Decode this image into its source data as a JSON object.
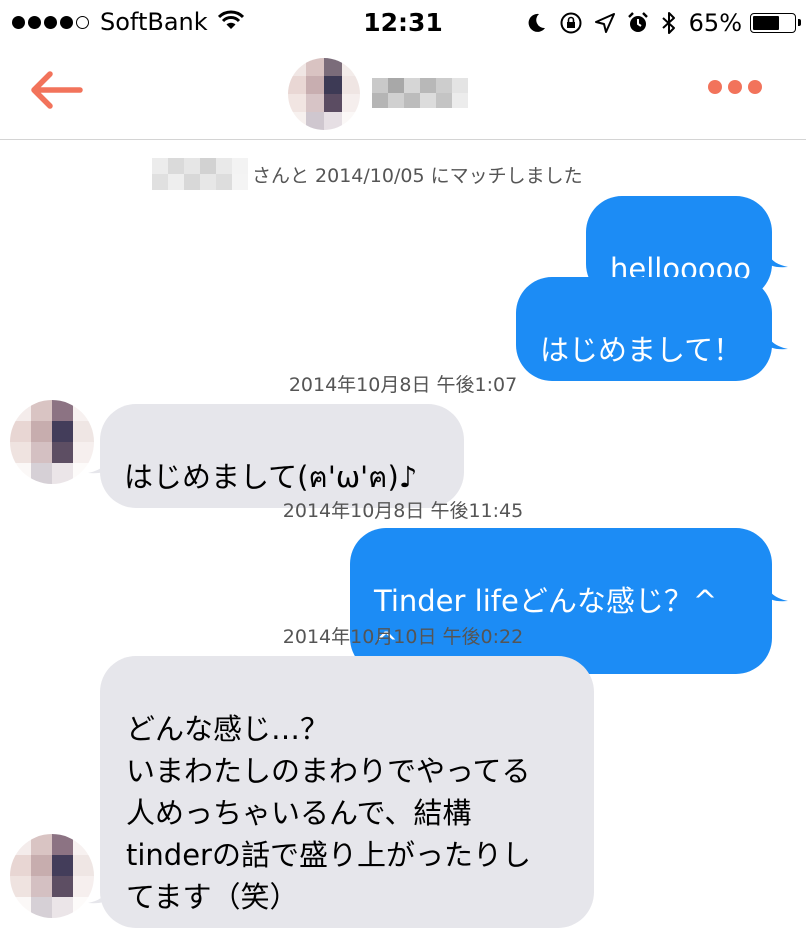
{
  "status_bar": {
    "carrier": "SoftBank",
    "time": "12:31",
    "battery": "65%",
    "battery_level": 0.65,
    "icons": [
      "signal-dots-icon",
      "wifi-icon",
      "moon-icon",
      "rotation-lock-icon",
      "location-icon",
      "alarm-icon",
      "bluetooth-icon",
      "battery-icon"
    ]
  },
  "nav": {
    "back_icon": "back-arrow-icon",
    "more_icon": "more-dots-icon",
    "accent": "#f2735b"
  },
  "chat": {
    "match_text": "さんと 2014/10/05 にマッチしました",
    "messages": [
      {
        "from": "me",
        "text": "hellooooo"
      },
      {
        "from": "me",
        "text": "はじめまして！"
      },
      {
        "timestamp": "2014年10月8日 午後1:07"
      },
      {
        "from": "them",
        "text": "はじめまして(ฅ'ω'ฅ)♪"
      },
      {
        "timestamp": "2014年10月8日 午後11:45"
      },
      {
        "from": "me",
        "text": "Tinder lifeどんな感じ？^ ^"
      },
      {
        "timestamp": "2014年10月10日 午後0:22"
      },
      {
        "from": "them",
        "text": "どんな感じ…？\nいまわたしのまわりでやってる\n人めっちゃいるんで、結構\ntinderの話で盛り上がったりし\nてます（笑）"
      }
    ]
  },
  "colors": {
    "outgoing_bubble": "#1c8cf5",
    "incoming_bubble": "#e6e6eb",
    "timestamp_text": "#555555"
  }
}
